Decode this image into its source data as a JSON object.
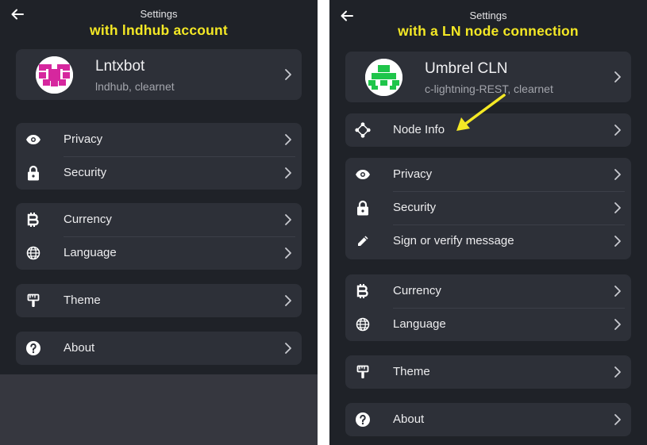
{
  "left": {
    "title": "Settings",
    "caption": "with lndhub account",
    "account": {
      "name": "Lntxbot",
      "subtitle": "lndhub, clearnet",
      "avatar_color": "#d6279e"
    },
    "items": {
      "privacy": "Privacy",
      "security": "Security",
      "currency": "Currency",
      "language": "Language",
      "theme": "Theme",
      "about": "About"
    }
  },
  "right": {
    "title": "Settings",
    "caption": "with a LN node connection",
    "account": {
      "name": "Umbrel CLN",
      "subtitle": "c-lightning-REST, clearnet",
      "avatar_color": "#1fc54a"
    },
    "items": {
      "node_info": "Node Info",
      "privacy": "Privacy",
      "security": "Security",
      "sign_verify": "Sign or verify message",
      "currency": "Currency",
      "language": "Language",
      "theme": "Theme",
      "about": "About"
    }
  },
  "colors": {
    "background": "#1f2228",
    "card": "#2d3038",
    "caption": "#f4e825",
    "arrow": "#f4e825"
  },
  "icons": [
    "back-arrow-icon",
    "eye-icon",
    "lock-icon",
    "bitcoin-icon",
    "globe-icon",
    "paint-roller-icon",
    "help-circle-icon",
    "node-info-icon",
    "pencil-icon",
    "chevron-right-icon"
  ]
}
